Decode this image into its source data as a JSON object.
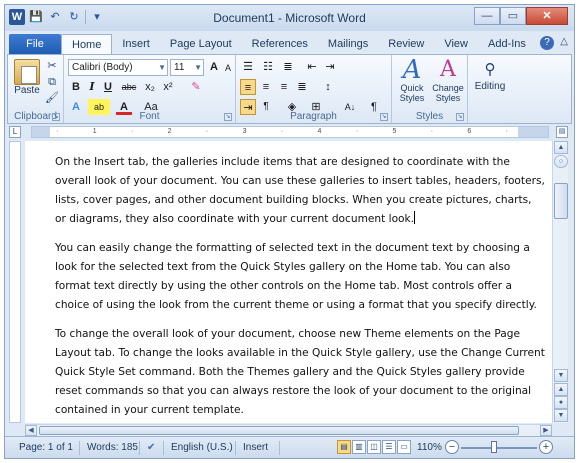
{
  "window": {
    "title": "Document1 - Microsoft Word",
    "app_logo": "W",
    "controls": {
      "minimize": "—",
      "maximize": "▭",
      "close": "✕"
    }
  },
  "qat": {
    "save": "💾",
    "undo": "↶",
    "redo": "↻",
    "customize": "▾"
  },
  "tabs": {
    "file": "File",
    "items": [
      "Home",
      "Insert",
      "Page Layout",
      "References",
      "Mailings",
      "Review",
      "View",
      "Add-Ins"
    ],
    "help": "?",
    "minimize_ribbon": "△"
  },
  "ribbon": {
    "clipboard": {
      "label": "Clipboard",
      "paste": "Paste"
    },
    "font": {
      "label": "Font",
      "font_name": "Calibri (Body)",
      "font_size": "11",
      "bold": "B",
      "italic": "I",
      "underline": "U",
      "strike": "abc",
      "subscript": "x₂",
      "superscript": "x²",
      "grow": "A",
      "shrink": "A",
      "change_case": "Aa",
      "highlight": "ab",
      "font_color": "A",
      "text_effects": "A",
      "clear": "✎"
    },
    "paragraph": {
      "label": "Paragraph",
      "pilcrow": "¶",
      "sort": "A↓"
    },
    "styles": {
      "label": "Styles",
      "quick_styles": "Quick Styles",
      "change_styles": "Change Styles"
    },
    "editing": {
      "label": "Editing",
      "editing": "Editing"
    }
  },
  "document": {
    "paragraphs": [
      "On the Insert tab, the galleries include items that are designed to coordinate with the overall look of your document. You can use these galleries to insert tables, headers, footers, lists, cover pages, and other document building blocks. When you create pictures, charts, or diagrams, they also coordinate with your current document look.",
      "You can easily change the formatting of selected text in the document text by choosing a look for the selected text from the Quick Styles gallery on the Home tab. You can also format text directly by using the other controls on the Home tab. Most controls offer a choice of using the look from the current theme or using a format that you specify directly.",
      "To change the overall look of your document, choose new Theme elements on the Page Layout tab. To change the looks available in the Quick Style gallery, use the Change Current Quick Style Set command. Both the Themes gallery and the Quick Styles gallery provide reset commands so that you can always restore the look of your document to the original contained in your current template."
    ]
  },
  "statusbar": {
    "page": "Page: 1 of 1",
    "words": "Words: 185",
    "language": "English (U.S.)",
    "mode": "Insert",
    "zoom": "110%",
    "zoom_out": "−",
    "zoom_in": "+"
  },
  "colors": {
    "accent": "#2b579a",
    "file_tab": "#1f5cb4",
    "ribbon": "#dde8f5"
  }
}
